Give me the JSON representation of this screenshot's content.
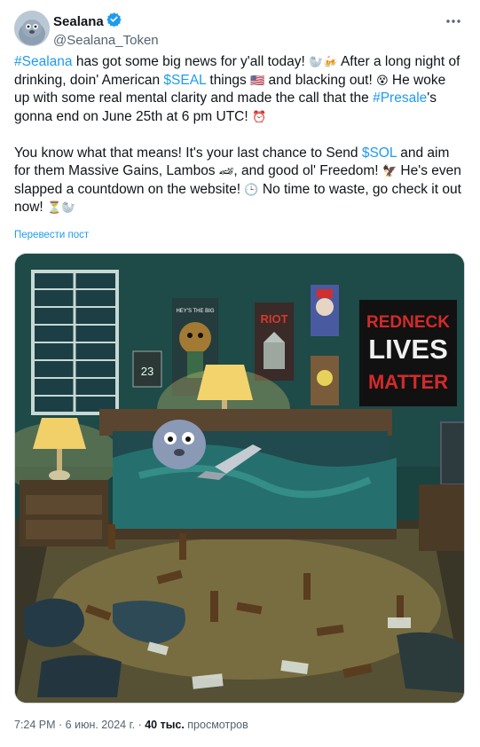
{
  "author": {
    "display_name": "Sealana",
    "handle": "@Sealana_Token",
    "verified_icon": "verified-badge-icon"
  },
  "tweet": {
    "p1": {
      "t1": "#Sealana",
      "t2": " has got some big news for y'all today! ",
      "t3": " After a long night of drinking, doin' American ",
      "t4": "$SEAL",
      "t5": " things ",
      "t6": " and blacking out! ",
      "t7": " He woke up with some real mental clarity and made the call that the ",
      "t8": "#Presale",
      "t9": "'s gonna end on June 25th at 6 pm UTC! "
    },
    "p2": {
      "t1": "You know what that means! It's your last chance to Send ",
      "t2": "$SOL",
      "t3": " and aim for them Massive Gains, Lambos ",
      "t4": ", and good ol' Freedom! ",
      "t5": " He's even slapped a countdown on the website! ",
      "t6": " No time to waste, go check it out now! "
    },
    "emoji": {
      "seal": "🦭",
      "beer": "🍻",
      "flag": "🇺🇸",
      "shock": "😵",
      "clock": "⏰",
      "rocket": "🚀",
      "car": "🏎",
      "eagle": "🦅",
      "clock2": "🕒",
      "hourglass": "⏳"
    }
  },
  "translate_link": "Перевести пост",
  "media": {
    "poster_lives_matter": [
      "REDNECK",
      "LIVES",
      "MATTER"
    ],
    "poster_riot": "RIOT",
    "poster_monster": "HEY'S THE BIG"
  },
  "meta": {
    "time": "7:24 PM",
    "sep1": " · ",
    "date": "6 июн. 2024 г.",
    "sep2": " · ",
    "views": "40 тыс.",
    "views_label": " просмотров"
  }
}
